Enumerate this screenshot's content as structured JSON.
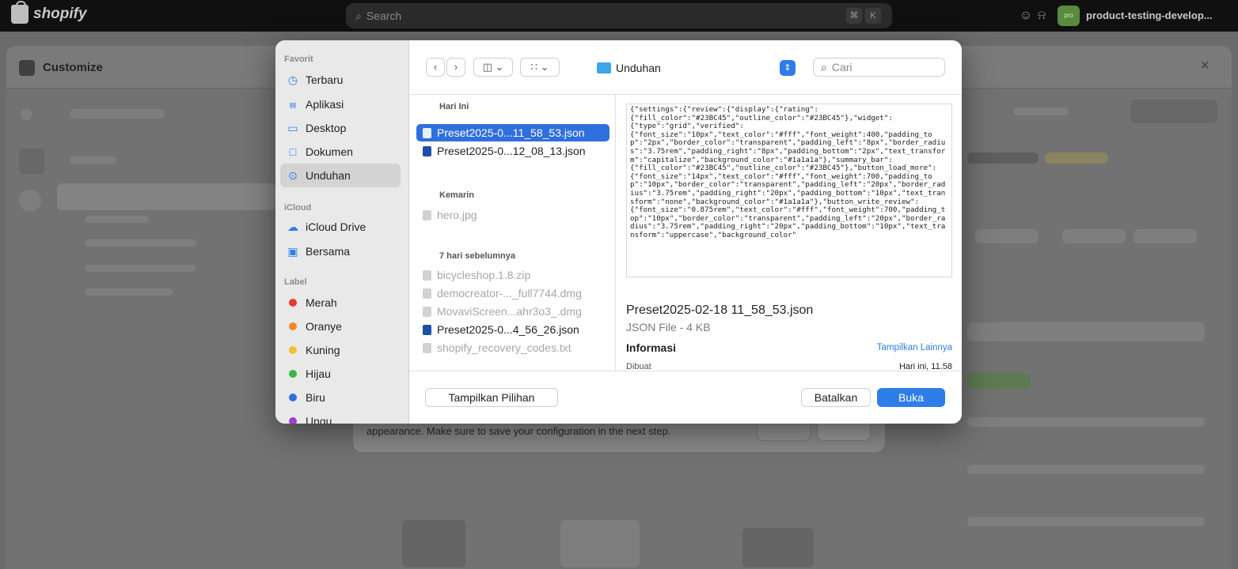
{
  "topbar": {
    "brand": "shopify",
    "search_placeholder": "Search",
    "shortcut_cmd": "⌘",
    "shortcut_key": "K",
    "store_badge": "pro",
    "store_name": "product-testing-develop..."
  },
  "customize": {
    "title": "Customize",
    "close": "×",
    "note_text": "appearance. Make sure to save your configuration in the next step."
  },
  "dialog": {
    "sidebar": {
      "favorites_label": "Favorit",
      "favorites": [
        {
          "label": "Terbaru",
          "icon": "clock-icon"
        },
        {
          "label": "Aplikasi",
          "icon": "applications-icon"
        },
        {
          "label": "Desktop",
          "icon": "desktop-icon"
        },
        {
          "label": "Dokumen",
          "icon": "document-icon"
        },
        {
          "label": "Unduhan",
          "icon": "download-icon"
        }
      ],
      "icloud_label": "iCloud",
      "icloud": [
        {
          "label": "iCloud Drive",
          "icon": "cloud-icon"
        },
        {
          "label": "Bersama",
          "icon": "shared-folder-icon"
        }
      ],
      "tags_label": "Label",
      "tags": [
        {
          "label": "Merah",
          "color": "#e8382f"
        },
        {
          "label": "Oranye",
          "color": "#f08a24"
        },
        {
          "label": "Kuning",
          "color": "#f2c32b"
        },
        {
          "label": "Hijau",
          "color": "#3bb54a"
        },
        {
          "label": "Biru",
          "color": "#2f6fdf"
        },
        {
          "label": "Ungu",
          "color": "#a03fd0"
        }
      ]
    },
    "toolbar": {
      "location": "Unduhan",
      "search_placeholder": "Cari"
    },
    "files": {
      "group_today": "Hari Ini",
      "today": [
        "Preset2025-0...11_58_53.json",
        "Preset2025-0...12_08_13.json"
      ],
      "group_yesterday": "Kemarin",
      "yesterday": [
        "hero.jpg"
      ],
      "group_week": "7 hari sebelumnya",
      "week": [
        "bicycleshop.1.8.zip",
        "democreator-..._full7744.dmg",
        "MovaviScreen...ahr3o3_.dmg",
        "Preset2025-0...4_56_26.json",
        "shopify_recovery_codes.txt"
      ]
    },
    "preview": {
      "content": "{\"settings\":{\"review\":{\"display\":{\"rating\":\n{\"fill_color\":\"#23BC45\",\"outline_color\":\"#23BC45\"},\"widget\":\n{\"type\":\"grid\",\"verified\":\n{\"font_size\":\"10px\",\"text_color\":\"#fff\",\"font_weight\":400,\"padding_top\":\"2px\",\"border_color\":\"transparent\",\"padding_left\":\"8px\",\"border_radius\":\"3.75rem\",\"padding_right\":\"8px\",\"padding_bottom\":\"2px\",\"text_transform\":\"capitalize\",\"background_color\":\"#1a1a1a\"},\"summary_bar\":\n{\"fill_color\":\"#23BC45\",\"outline_color\":\"#23BC45\"},\"button_load_more\":\n{\"font_size\":\"14px\",\"text_color\":\"#fff\",\"font_weight\":700,\"padding_top\":\"10px\",\"border_color\":\"transparent\",\"padding_left\":\"20px\",\"border_radius\":\"3.75rem\",\"padding_right\":\"20px\",\"padding_bottom\":\"10px\",\"text_transform\":\"none\",\"background_color\":\"#1a1a1a\"},\"button_write_review\":\n{\"font_size\":\"0.875rem\",\"text_color\":\"#fff\",\"font_weight\":700,\"padding_top\":\"10px\",\"border_color\":\"transparent\",\"padding_left\":\"20px\",\"border_radius\":\"3.75rem\",\"padding_right\":\"20px\",\"padding_bottom\":\"10px\",\"text_transform\":\"uppercase\",\"background_color\"",
      "filename": "Preset2025-02-18 11_58_53.json",
      "type": "JSON File - 4 KB",
      "info_label": "Informasi",
      "show_more": "Tampilkan Lainnya",
      "created_label": "Dibuat",
      "created_value": "Hari ini, 11.58"
    },
    "footer": {
      "options_label": "Tampilkan Pilihan",
      "cancel_label": "Batalkan",
      "open_label": "Buka"
    }
  }
}
